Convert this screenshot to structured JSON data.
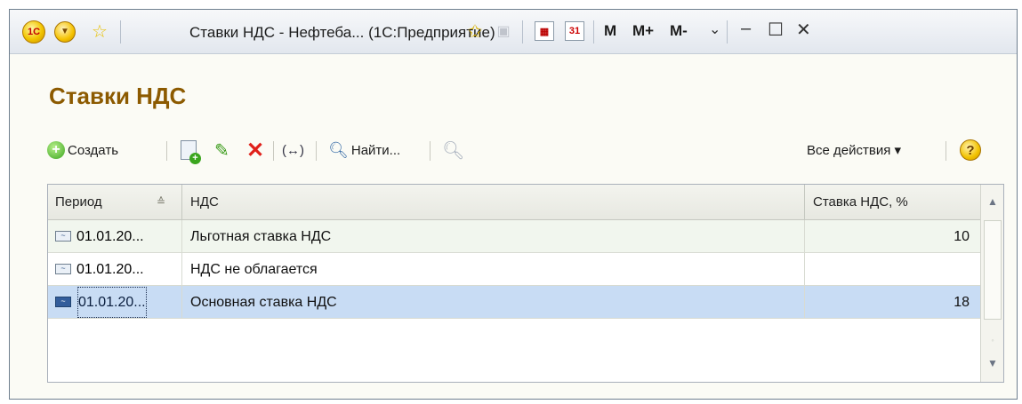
{
  "window": {
    "title": "Ставки НДС - Нефтеба... (1С:Предприятие)",
    "logo_text": "1С",
    "buttons": {
      "m": "M",
      "m_plus": "M+",
      "m_minus": "M-",
      "dropdown": "⌄",
      "minimize": "–",
      "maximize": "☐",
      "close": "✕"
    }
  },
  "form": {
    "title": "Ставки НДС"
  },
  "toolbar": {
    "create_label": "Создать",
    "find_label": "Найти...",
    "all_actions_label": "Все действия ▾",
    "help_label": "?"
  },
  "table": {
    "columns": {
      "period": "Период",
      "vat": "НДС",
      "rate": "Ставка НДС, %"
    },
    "rows": [
      {
        "period": "01.01.20...",
        "vat": "Льготная ставка НДС",
        "rate": "10",
        "selected": false
      },
      {
        "period": "01.01.20...",
        "vat": "НДС не облагается",
        "rate": "",
        "selected": false
      },
      {
        "period": "01.01.20...",
        "vat": "Основная ставка НДС",
        "rate": "18",
        "selected": true
      }
    ]
  },
  "icons": {
    "period_icon": "~"
  },
  "colors": {
    "form_title": "#8c5a00",
    "selected_row": "#c8dcf4",
    "alt_row": "#f1f6ee",
    "delete": "#e0201a",
    "create": "#3aa51e"
  }
}
